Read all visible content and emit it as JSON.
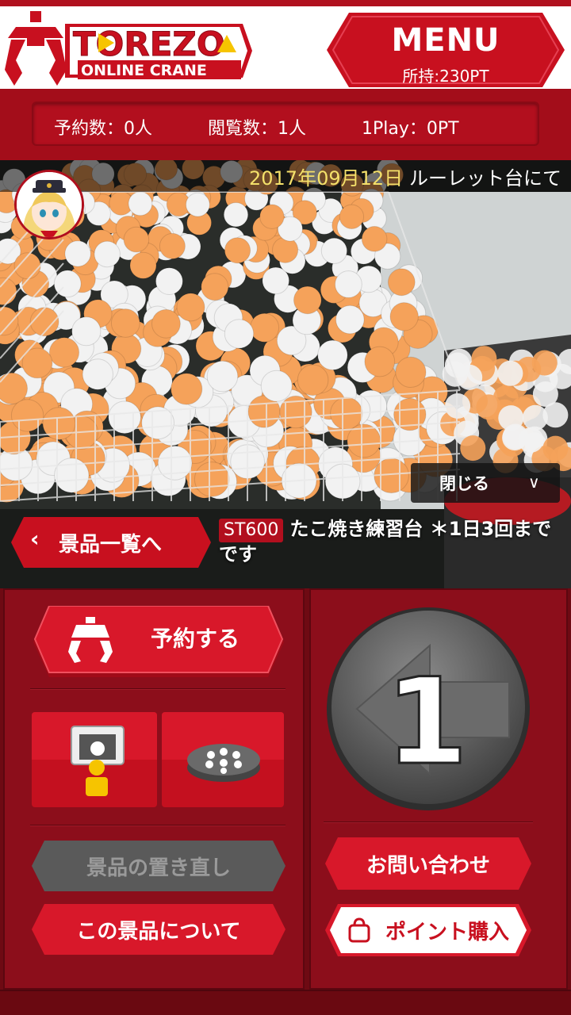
{
  "header": {
    "logo_text_line1": "TOREZO",
    "logo_text_line2": "ONLINE CRANE",
    "menu_label": "MENU",
    "points_held": "所持:230PT"
  },
  "stats": {
    "reservations": "予約数：0人",
    "viewers": "閲覧数：1人",
    "play_cost": "1Play：0PT"
  },
  "video": {
    "ticker_date": "2017年09月12日",
    "ticker_text": "ルーレット台にて",
    "close_label": "閉じる",
    "close_icon": "chevron-down-icon",
    "back_label": "景品一覧へ",
    "prize_code": "ST600",
    "prize_name": "たこ焼き練習台 ＊1日3回までです"
  },
  "controls": {
    "reserve_label": "予約する",
    "reset_label": "景品の置き直し",
    "about_label": "この景品について",
    "contact_label": "お問い合わせ",
    "buy_points_label": "ポイント購入",
    "play_step": "1"
  },
  "colors": {
    "brand_red": "#c8101f",
    "panel_red": "#8c0e1b",
    "disabled_gray": "#5a5a5a",
    "ticker_date": "#f4e06a"
  }
}
